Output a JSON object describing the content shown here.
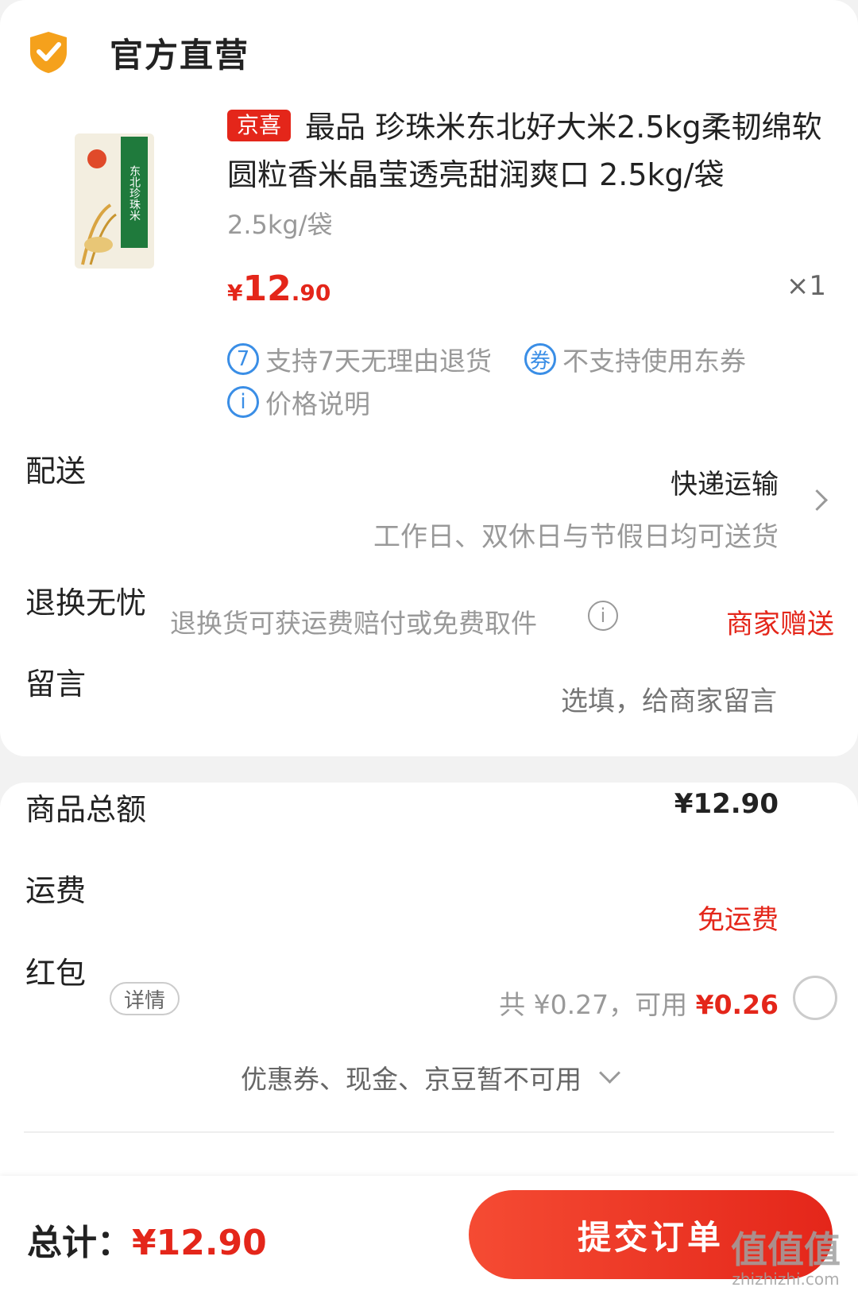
{
  "store": {
    "name": "官方直营",
    "icon": "shield-check-icon"
  },
  "product": {
    "tag": "京喜",
    "title": "最品 珍珠米东北好大米2.5kg柔韧绵软圆粒香米晶莹透亮甜润爽口 2.5kg/袋",
    "spec": "2.5kg/袋",
    "price_currency": "¥",
    "price_int": "12",
    "price_dec": ".90",
    "quantity": "×1",
    "image_text": "东北珍珠米",
    "services": [
      {
        "icon": "7",
        "icon_name": "seven-day-return-icon",
        "label": "支持7天无理由退货"
      },
      {
        "icon": "券",
        "icon_name": "no-coupon-icon",
        "label": "不支持使用东券"
      },
      {
        "icon": "i",
        "icon_name": "info-icon",
        "label": "价格说明"
      }
    ]
  },
  "delivery": {
    "label": "配送",
    "method": "快递运输",
    "note": "工作日、双休日与节假日均可送货"
  },
  "returns": {
    "label": "退换无忧",
    "note": "退换货可获运费赔付或免费取件",
    "gift": "商家赠送"
  },
  "message": {
    "label": "留言",
    "placeholder": "选填，给商家留言"
  },
  "summary": {
    "goods_label": "商品总额",
    "goods_amount": "¥12.90",
    "shipping_label": "运费",
    "shipping_value": "免运费",
    "redpack_label": "红包",
    "redpack_detail": "详情",
    "redpack_total": "共 ¥0.27，可用 ",
    "redpack_usable": "¥0.26",
    "unavailable_text": "优惠券、现金、京豆暂不可用"
  },
  "footer": {
    "total_label": "总计：",
    "total_amount": "¥12.90",
    "submit_label": "提交订单"
  },
  "watermark": {
    "main": "值值值",
    "sub": "zhizhizhi.com"
  },
  "colors": {
    "accent": "#e4261a",
    "info_blue": "#3a8ee6",
    "shield_orange": "#f5a11c"
  }
}
